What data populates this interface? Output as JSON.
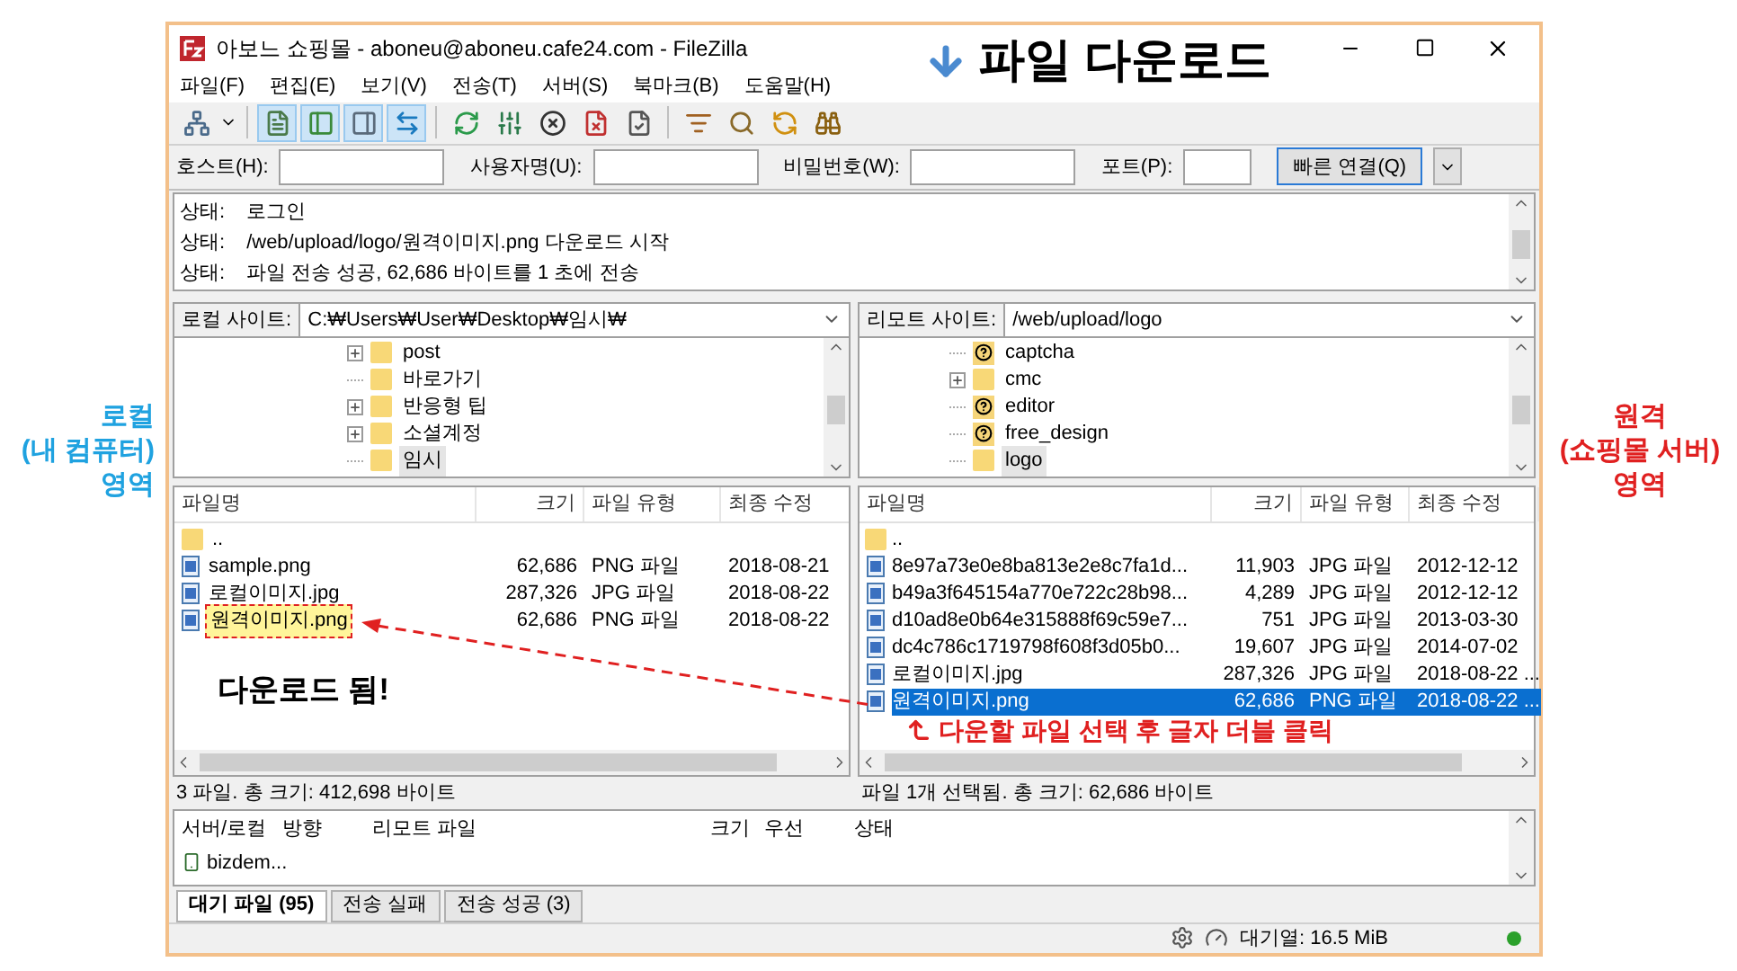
{
  "annotations": {
    "title": "파일 다운로드",
    "local_label": [
      "로컬",
      "(내 컴퓨터)",
      "영역"
    ],
    "remote_label": [
      "원격",
      "(쇼핑몰 서버)",
      "영역"
    ],
    "downloaded_note": "다운로드 됨!",
    "instruction": "다운할 파일 선택 후 글자 더블 클릭"
  },
  "window": {
    "title": "아보느 쇼핑몰 - aboneu@aboneu.cafe24.com - FileZilla"
  },
  "menu": [
    "파일(F)",
    "편집(E)",
    "보기(V)",
    "전송(T)",
    "서버(S)",
    "북마크(B)",
    "도움말(H)"
  ],
  "toolbar": [
    {
      "kind": "sites",
      "active": false
    },
    {
      "kind": "log",
      "active": true
    },
    {
      "kind": "localtree",
      "active": true
    },
    {
      "kind": "remotetree",
      "active": true
    },
    {
      "kind": "queue",
      "active": true
    },
    {
      "kind": "refresh",
      "active": false
    },
    {
      "kind": "filters",
      "active": false
    },
    {
      "kind": "cancel",
      "active": false
    },
    {
      "kind": "disconnect",
      "active": false
    },
    {
      "kind": "reconnect",
      "active": false
    },
    {
      "kind": "listing",
      "active": false
    },
    {
      "kind": "search",
      "active": false
    },
    {
      "kind": "sync",
      "active": false
    },
    {
      "kind": "find",
      "active": false
    }
  ],
  "quickconnect": {
    "fields": [
      {
        "label": "호스트(H):"
      },
      {
        "label": "사용자명(U):"
      },
      {
        "label": "비밀번호(W):"
      },
      {
        "label": "포트(P):"
      }
    ],
    "button": "빠른 연결(Q)"
  },
  "log": [
    {
      "label": "상태:",
      "text": "로그인"
    },
    {
      "label": "상태:",
      "text": "/web/upload/logo/원격이미지.png 다운로드 시작"
    },
    {
      "label": "상태:",
      "text": "파일 전송 성공, 62,686 바이트를 1 초에 전송"
    }
  ],
  "local": {
    "site_label": "로컬 사이트:",
    "path": "C:₩Users₩User₩Desktop₩임시₩",
    "tree": [
      {
        "name": "post",
        "kind": "folder",
        "expandable": true,
        "selected": false
      },
      {
        "name": "바로가기",
        "kind": "folder",
        "expandable": false,
        "selected": false
      },
      {
        "name": "반응형 팁",
        "kind": "folder",
        "expandable": true,
        "selected": false
      },
      {
        "name": "소셜계정",
        "kind": "folder",
        "expandable": true,
        "selected": false
      },
      {
        "name": "임시",
        "kind": "folder",
        "expandable": false,
        "selected": true
      }
    ],
    "columns": [
      "파일명",
      "크기",
      "파일 유형",
      "최종 수정"
    ],
    "rows": [
      {
        "kind": "folder",
        "name": "..",
        "size": "",
        "type": "",
        "modified": "",
        "highlighted": false
      },
      {
        "kind": "file",
        "name": "sample.png",
        "size": "62,686",
        "type": "PNG 파일",
        "modified": "2018-08-21",
        "highlighted": false
      },
      {
        "kind": "file",
        "name": "로컬이미지.jpg",
        "size": "287,326",
        "type": "JPG 파일",
        "modified": "2018-08-22",
        "highlighted": false
      },
      {
        "kind": "file",
        "name": "원격이미지.png",
        "size": "62,686",
        "type": "PNG 파일",
        "modified": "2018-08-22",
        "highlighted": true
      }
    ],
    "status": "3 파일. 총 크기: 412,698 바이트"
  },
  "remote": {
    "site_label": "리모트 사이트:",
    "path": "/web/upload/logo",
    "tree": [
      {
        "name": "captcha",
        "kind": "unknown",
        "expandable": false,
        "selected": false
      },
      {
        "name": "cmc",
        "kind": "folder",
        "expandable": true,
        "selected": false
      },
      {
        "name": "editor",
        "kind": "unknown",
        "expandable": false,
        "selected": false
      },
      {
        "name": "free_design",
        "kind": "unknown",
        "expandable": false,
        "selected": false
      },
      {
        "name": "logo",
        "kind": "folder",
        "expandable": false,
        "selected": true
      }
    ],
    "columns": [
      "파일명",
      "크기",
      "파일 유형",
      "최종 수정"
    ],
    "rows": [
      {
        "kind": "folder",
        "name": "..",
        "size": "",
        "type": "",
        "modified": "",
        "selected": false
      },
      {
        "kind": "file",
        "name": "8e97a73e0e8ba813e2e8c7fa1d...",
        "size": "11,903",
        "type": "JPG 파일",
        "modified": "2012-12-12",
        "selected": false
      },
      {
        "kind": "file",
        "name": "b49a3f645154a770e722c28b98...",
        "size": "4,289",
        "type": "JPG 파일",
        "modified": "2012-12-12",
        "selected": false
      },
      {
        "kind": "file",
        "name": "d10ad8e0b64e315888f69c59e7...",
        "size": "751",
        "type": "JPG 파일",
        "modified": "2013-03-30",
        "selected": false
      },
      {
        "kind": "file",
        "name": "dc4c786c1719798f608f3d05b0...",
        "size": "19,607",
        "type": "JPG 파일",
        "modified": "2014-07-02",
        "selected": false
      },
      {
        "kind": "file",
        "name": "로컬이미지.jpg",
        "size": "287,326",
        "type": "JPG 파일",
        "modified": "2018-08-22 ...",
        "selected": false
      },
      {
        "kind": "file",
        "name": "원격이미지.png",
        "size": "62,686",
        "type": "PNG 파일",
        "modified": "2018-08-22 ...",
        "selected": true
      }
    ],
    "status": "파일 1개 선택됨. 총 크기: 62,686 바이트"
  },
  "queue": {
    "columns": [
      "서버/로컬",
      "방향",
      "리모트 파일",
      "크기",
      "우선",
      "상태"
    ],
    "rows": [
      {
        "server": "bizdem..."
      }
    ]
  },
  "tabs": [
    {
      "label": "대기 파일 (95)",
      "selected": true
    },
    {
      "label": "전송 실패",
      "selected": false
    },
    {
      "label": "전송 성공 (3)",
      "selected": false
    }
  ],
  "status_bar": {
    "queue": "대기열: 16.5 MiB"
  }
}
